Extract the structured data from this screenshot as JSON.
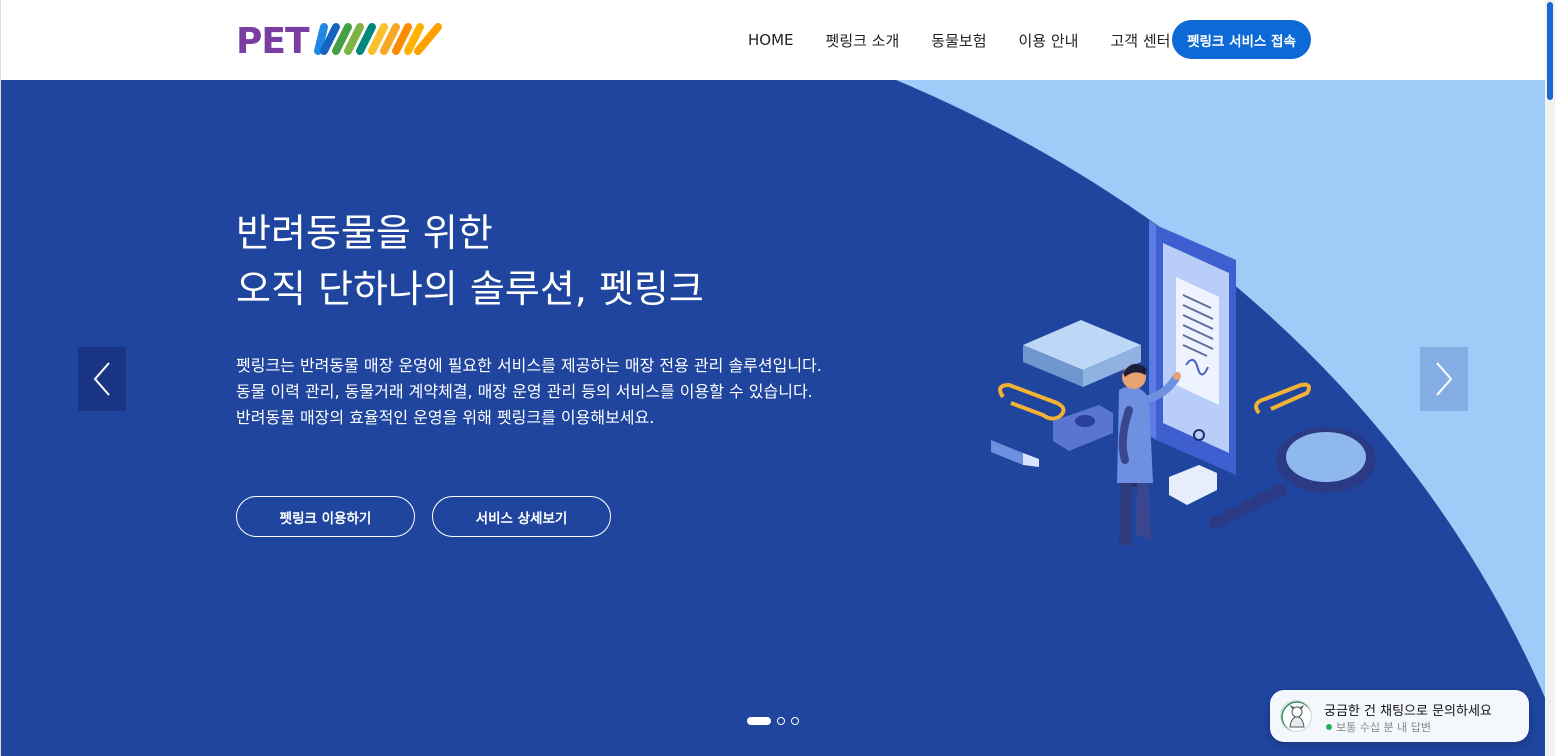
{
  "header": {
    "logo_text": "PETLINK",
    "nav": [
      "HOME",
      "펫링크 소개",
      "동물보험",
      "이용 안내",
      "고객 센터"
    ],
    "cta_label": "펫링크 서비스 접속"
  },
  "hero": {
    "title_line1": "반려동물을 위한",
    "title_line2": "오직 단하나의 솔루션, 펫링크",
    "desc_line1": "펫링크는 반려동물 매장 운영에 필요한 서비스를 제공하는 매장 전용 관리 솔루션입니다.",
    "desc_line2": "동물 이력 관리, 동물거래 계약체결, 매장 운영 관리 등의 서비스를 이용할 수 있습니다.",
    "desc_line3": "반려동물 매장의 효율적인 운영을 위해 펫링크를 이용해보세요.",
    "button_primary": "펫링크 이용하기",
    "button_secondary": "서비스 상세보기",
    "slide_count": 3,
    "active_slide": 1,
    "prev_icon": "chevron-left-icon",
    "next_icon": "chevron-right-icon"
  },
  "chat": {
    "title": "궁금한 건 채팅으로 문의하세요",
    "status": "보통 수십 분 내 답변"
  },
  "colors": {
    "hero_dark": "#1f459e",
    "hero_light": "#9fcbf9",
    "cta": "#0d69d6",
    "logo_purple": "#7a3ea3",
    "status_green": "#22b45a"
  }
}
